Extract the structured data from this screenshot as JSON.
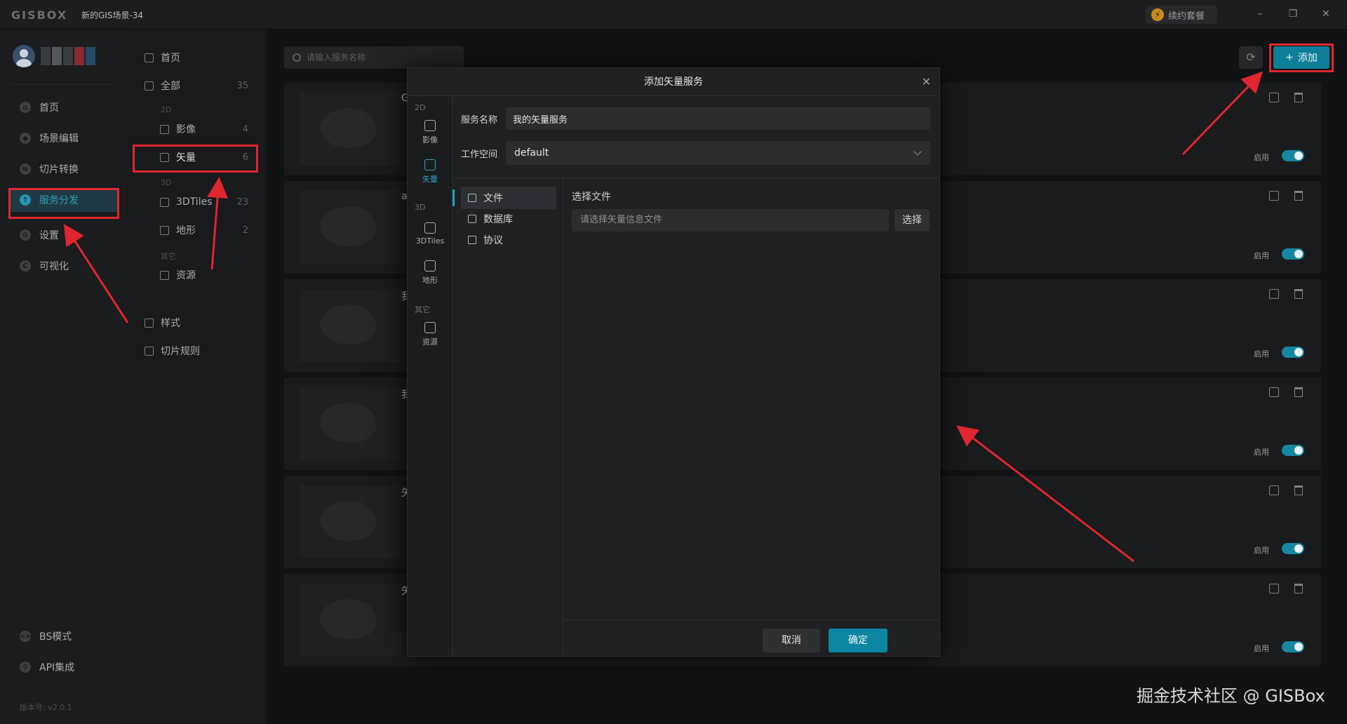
{
  "app": {
    "logo": "GISBOX",
    "scene_title": "新的GIS场景-34",
    "renew_label": "续约套餐",
    "window_controls": [
      "minimize-icon",
      "restore-icon",
      "close-icon"
    ]
  },
  "leftnav": {
    "items": [
      {
        "label": "首页",
        "icon": "home-icon"
      },
      {
        "label": "场景编辑",
        "icon": "scene-edit-icon"
      },
      {
        "label": "切片转换",
        "icon": "tile-convert-icon"
      },
      {
        "label": "服务分发",
        "icon": "service-publish-icon",
        "active": true
      },
      {
        "label": "设置",
        "icon": "settings-icon"
      },
      {
        "label": "可视化",
        "icon": "visualize-icon"
      }
    ],
    "bottom_items": [
      {
        "label": "BS模式",
        "icon": "code-icon"
      },
      {
        "label": "API集成",
        "icon": "api-icon"
      }
    ],
    "version": "版本号: v2.0.1"
  },
  "catpanel": {
    "home": "首页",
    "all": {
      "label": "全部",
      "count": "35"
    },
    "group_2d": "2D",
    "imagery": {
      "label": "影像",
      "count": "4"
    },
    "vector": {
      "label": "矢量",
      "count": "6"
    },
    "group_3d": "3D",
    "tiles3d": {
      "label": "3DTiles",
      "count": "23"
    },
    "terrain": {
      "label": "地形",
      "count": "2"
    },
    "group_other": "其它",
    "resource": {
      "label": "资源"
    },
    "style": "样式",
    "tile_rules": "切片规则"
  },
  "toolbar": {
    "search_placeholder": "请输入服务名称",
    "add_label": "添加"
  },
  "cards": [
    {
      "letter": "G",
      "status": "启用"
    },
    {
      "letter": "a",
      "status": "启用"
    },
    {
      "letter": "我",
      "status": "启用"
    },
    {
      "letter": "我",
      "status": "启用"
    },
    {
      "letter": "矢",
      "status": "启用"
    },
    {
      "letter": "矢",
      "status": "启用"
    }
  ],
  "modal": {
    "title": "添加矢量服务",
    "types": {
      "group_2d": "2D",
      "imagery": "影像",
      "vector": "矢量",
      "group_3d": "3D",
      "tiles3d": "3DTiles",
      "terrain": "地形",
      "group_other": "其它",
      "resource": "资源"
    },
    "service_name_label": "服务名称",
    "service_name_value": "我的矢量服务",
    "workspace_label": "工作空间",
    "workspace_value": "default",
    "sources": [
      "文件",
      "数据库",
      "协议"
    ],
    "file_label": "选择文件",
    "file_placeholder": "请选择矢量信息文件",
    "choose_label": "选择",
    "cancel_label": "取消",
    "ok_label": "确定"
  },
  "watermark": "掘金技术社区 @ GISBox",
  "colors": {
    "accent": "#0e7f99",
    "annotation": "#e0262e"
  }
}
